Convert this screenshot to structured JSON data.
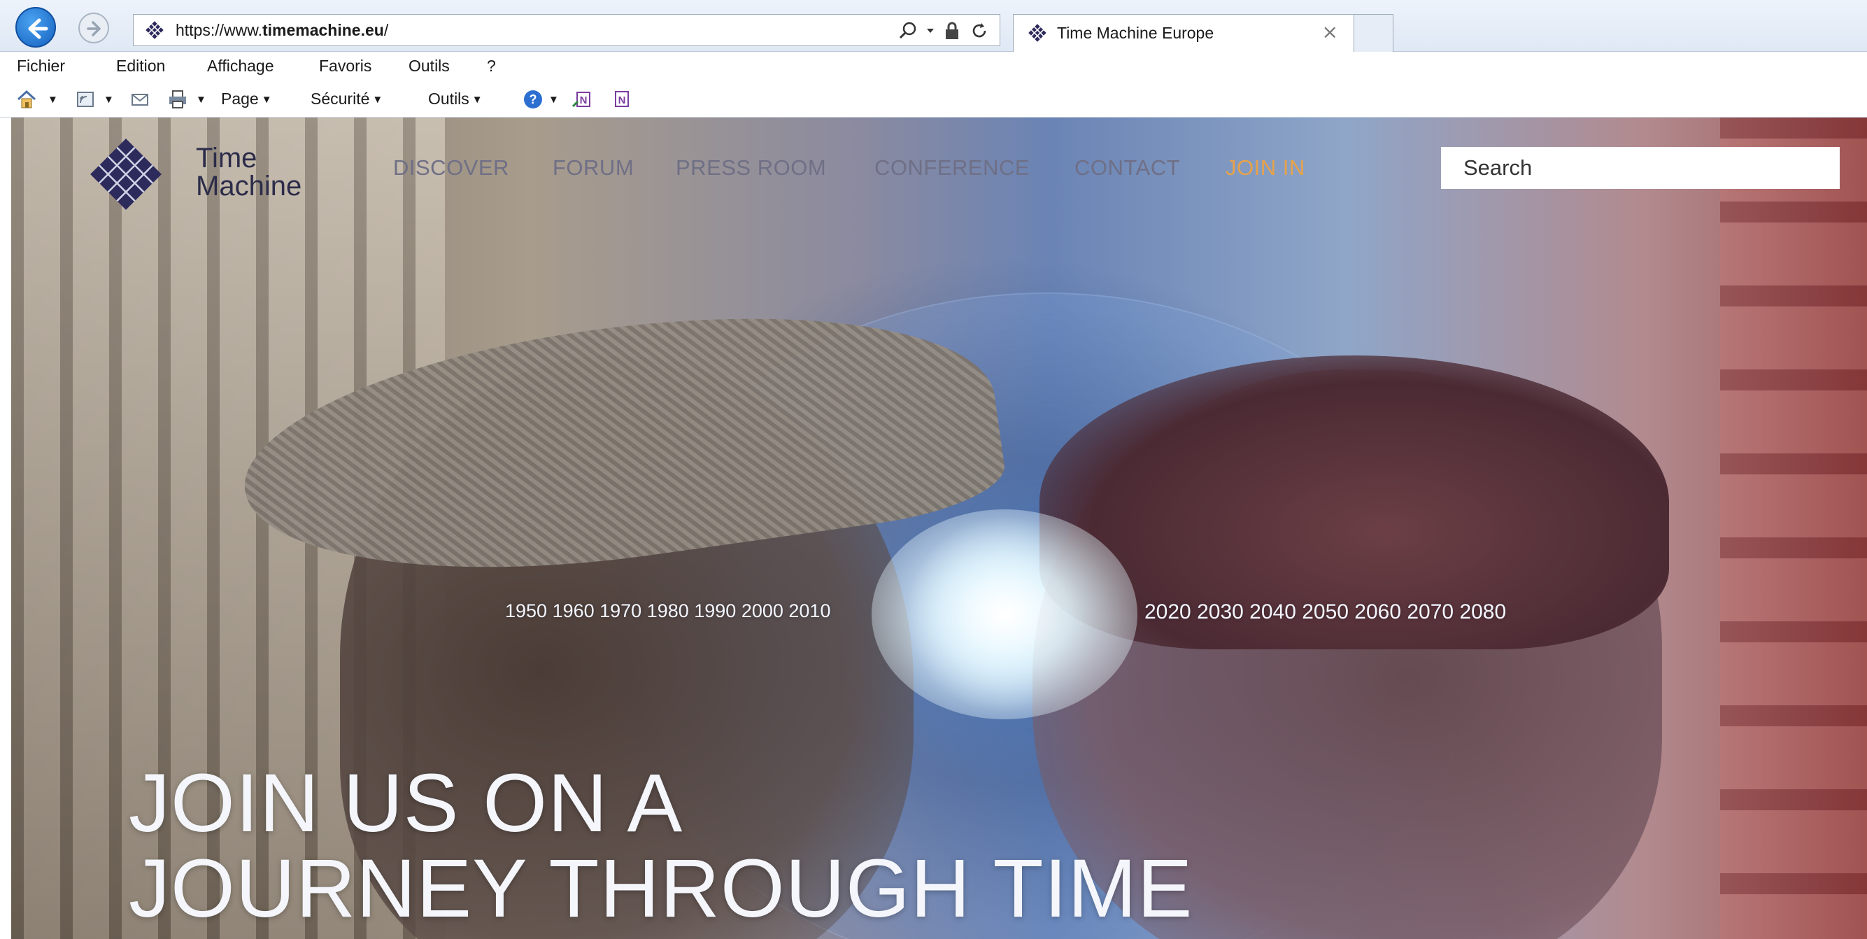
{
  "browser": {
    "url_prefix": "https://www.",
    "url_domain": "timemachine.eu",
    "url_suffix": "/",
    "tab_title": "Time Machine Europe",
    "tab_close": "×"
  },
  "menu": {
    "items": [
      "Fichier",
      "Edition",
      "Affichage",
      "Favoris",
      "Outils",
      "?"
    ]
  },
  "command_bar": {
    "page": "Page",
    "security": "Sécurité",
    "tools": "Outils"
  },
  "site": {
    "logo_line1": "Time",
    "logo_line2": "Machine",
    "nav": {
      "discover": "DISCOVER",
      "forum": "FORUM",
      "press_room": "PRESS ROOM",
      "conference": "CONFERENCE",
      "contact": "CONTACT",
      "join_in": "JOIN IN"
    },
    "search_placeholder": "Search",
    "hero_line1": "JOIN US ON A",
    "hero_line2": "JOURNEY THROUGH TIME",
    "years_past": "1950 1960 1970 1980 1990 2000 2010",
    "years_future": "2020 2030 2040 2050 2060 2070 2080"
  },
  "colors": {
    "join_accent": "#e7a24a",
    "nav_text": "#6f6f86",
    "logo_purple": "#2d2a5c"
  }
}
